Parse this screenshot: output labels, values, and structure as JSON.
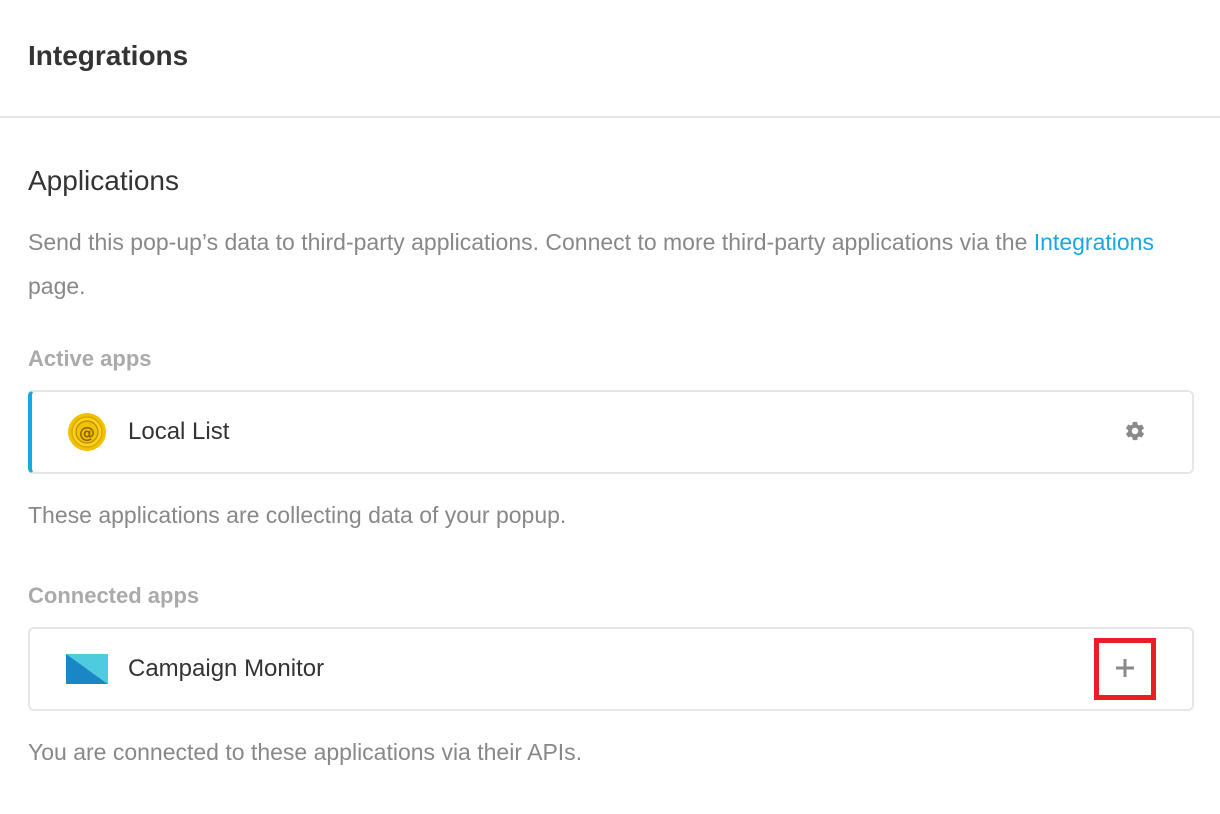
{
  "header": {
    "title": "Integrations"
  },
  "applications": {
    "title": "Applications",
    "description_before_link": "Send this pop-up’s data to third-party applications. Connect to more third-party applications via the ",
    "link_text": "Integrations",
    "description_after_link": " page."
  },
  "active_apps": {
    "label": "Active apps",
    "items": [
      {
        "name": "Local List",
        "icon": "local-list-icon",
        "action_icon": "gear-icon"
      }
    ],
    "note": "These applications are collecting data of your popup."
  },
  "connected_apps": {
    "label": "Connected apps",
    "items": [
      {
        "name": "Campaign Monitor",
        "icon": "campaign-monitor-icon",
        "action_icon": "plus-icon"
      }
    ],
    "note": "You are connected to these applications via their APIs."
  },
  "colors": {
    "accent": "#17a8e3",
    "highlight": "#ee1c25",
    "local_list_gold": "#f2c200",
    "campaign_monitor_dark": "#1a86c4",
    "campaign_monitor_light": "#4fcbe0"
  }
}
